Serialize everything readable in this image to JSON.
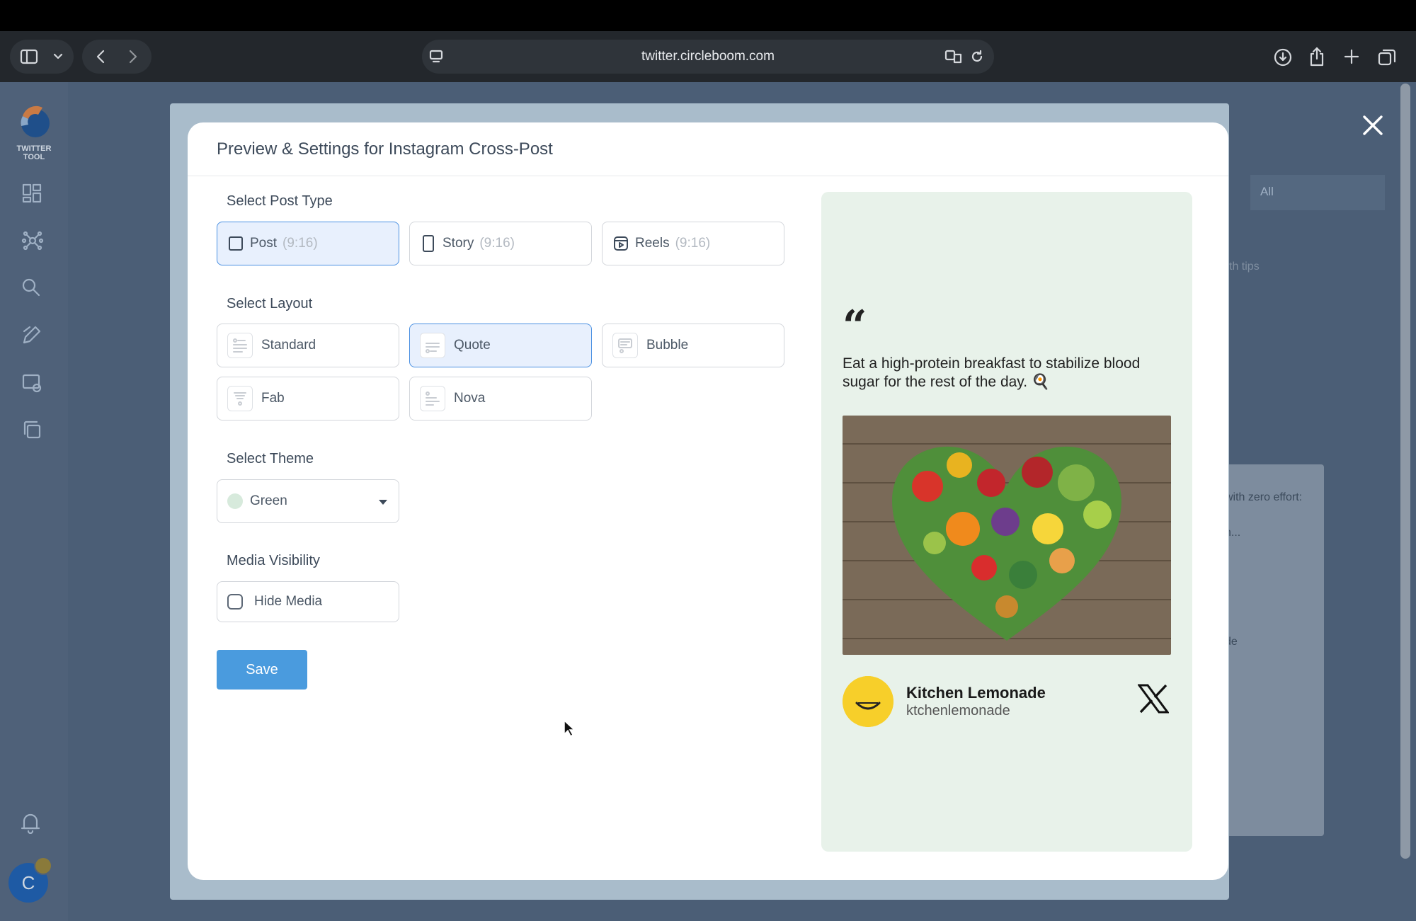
{
  "browser": {
    "url": "twitter.circleboom.com"
  },
  "app": {
    "logo_text": "TWITTER TOOL",
    "bg_tabs_text": "",
    "bg_select_value": "All",
    "bg_panel_text_1": "with zero effort:",
    "bg_panel_text_2": "h...",
    "bg_panel_text_3": "de",
    "bg_panel_text_4": "th tips",
    "user_initial": "C"
  },
  "modal": {
    "title": "Preview & Settings for Instagram Cross-Post",
    "post_type": {
      "label": "Select Post Type",
      "options": [
        {
          "label": "Post",
          "ratio": "(9:16)",
          "icon": "square-icon",
          "selected": true
        },
        {
          "label": "Story",
          "ratio": "(9:16)",
          "icon": "phone-icon",
          "selected": false
        },
        {
          "label": "Reels",
          "ratio": "(9:16)",
          "icon": "reels-icon",
          "selected": false
        }
      ]
    },
    "layout": {
      "label": "Select Layout",
      "options": [
        {
          "label": "Standard",
          "selected": false
        },
        {
          "label": "Quote",
          "selected": true
        },
        {
          "label": "Bubble",
          "selected": false
        },
        {
          "label": "Fab",
          "selected": false
        },
        {
          "label": "Nova",
          "selected": false
        }
      ]
    },
    "theme": {
      "label": "Select Theme",
      "value": "Green",
      "dot_color": "#d7eadc"
    },
    "media": {
      "label": "Media Visibility",
      "checkbox_label": "Hide Media",
      "checked": false
    },
    "save_label": "Save"
  },
  "preview": {
    "quote_mark": "“",
    "text": "Eat a high-protein breakfast to stabilize blood sugar for the rest of the day. 🍳",
    "author_name": "Kitchen Lemonade",
    "author_handle": "ktchenlemonade",
    "background": "#e8f2ea"
  }
}
